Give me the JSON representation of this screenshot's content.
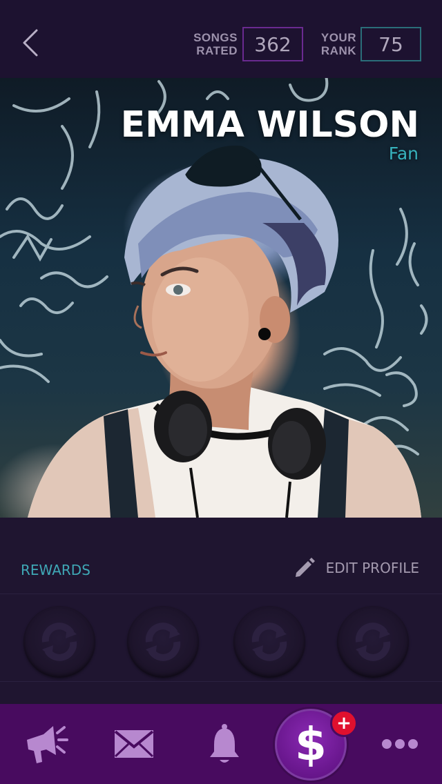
{
  "header": {
    "back_icon": "chevron-left-icon",
    "songs_rated_label_line1": "SONGS",
    "songs_rated_label_line2": "RATED",
    "songs_rated_value": "362",
    "your_rank_label_line1": "YOUR",
    "your_rank_label_line2": "RANK",
    "your_rank_value": "75",
    "songs_box_color": "#6a2a90",
    "rank_box_color": "#2a6e79"
  },
  "profile": {
    "name": "EMMA WILSON",
    "role": "Fan",
    "role_color": "#37b2bd"
  },
  "section": {
    "rewards_label": "REWARDS",
    "edit_profile_label": "EDIT PROFILE",
    "edit_icon": "pencil-icon",
    "reward_badges": [
      {
        "icon": "reward-badge-locked"
      },
      {
        "icon": "reward-badge-locked"
      },
      {
        "icon": "reward-badge-locked"
      },
      {
        "icon": "reward-badge-locked"
      }
    ]
  },
  "nav": {
    "items": [
      {
        "icon": "megaphone-icon"
      },
      {
        "icon": "envelope-icon"
      },
      {
        "icon": "bell-icon"
      },
      {
        "icon": "dollar-icon",
        "glyph": "$"
      },
      {
        "icon": "more-icon"
      }
    ],
    "plus_badge": "+",
    "background": "#480b5f",
    "badge_color": "#e0102e"
  }
}
